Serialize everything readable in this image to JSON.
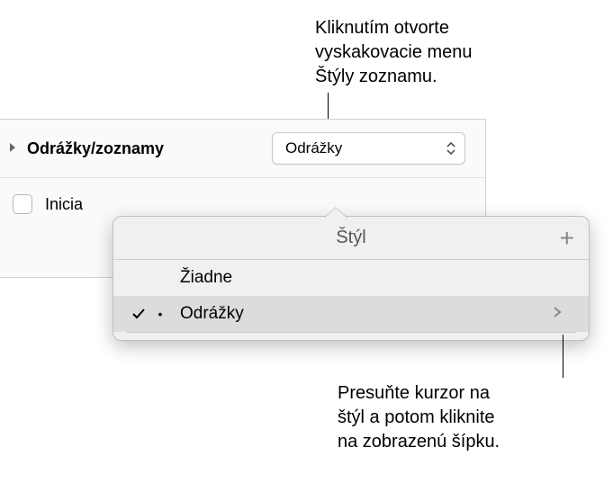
{
  "callouts": {
    "top": "Kliknutím otvorte\nvyskakovacie menu\nŠtýly zoznamu.",
    "bottom": "Presuňte kurzor na\nštýl a potom kliknite\nna zobrazenú šípku."
  },
  "panel": {
    "bullets_label": "Odrážky/zoznamy",
    "popup_value": "Odrážky",
    "dropcap_label": "Inicia"
  },
  "popover": {
    "title": "Štýl",
    "items": [
      {
        "label": "Žiadne",
        "selected": false,
        "bullet": ""
      },
      {
        "label": "Odrážky",
        "selected": true,
        "bullet": "•"
      }
    ]
  }
}
